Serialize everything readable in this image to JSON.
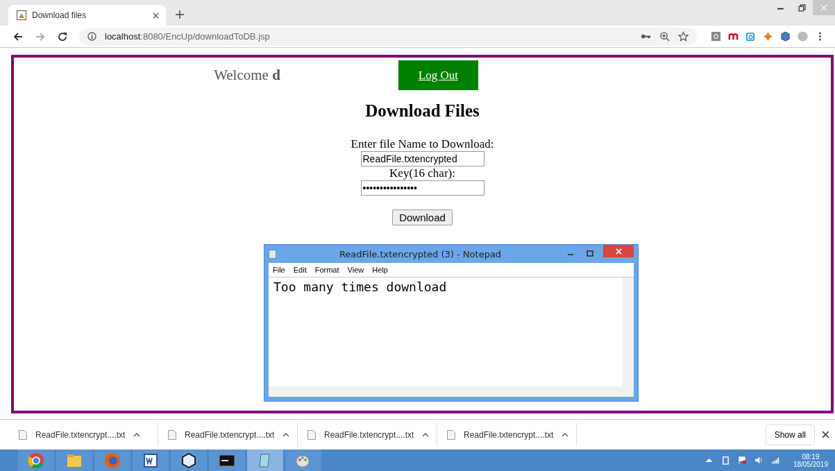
{
  "browser": {
    "tab_title": "Download files",
    "url_host": "localhost",
    "url_path": ":8080/EncUp/downloadToDB.jsp"
  },
  "page": {
    "welcome": "Welcome **d**",
    "logout": "Log Out",
    "heading": "Download Files",
    "file_label": "Enter file Name to Download:",
    "file_value": "ReadFile.txtencrypted",
    "key_label": "Key(16 char):",
    "key_value": "••••••••••••••••",
    "download": "Download"
  },
  "notepad": {
    "title": "ReadFile.txtencrypted (3) - Notepad",
    "menu": [
      "File",
      "Edit",
      "Format",
      "View",
      "Help"
    ],
    "text": "Too many times download"
  },
  "downloads": [
    {
      "name": "ReadFile.txtencrypt....txt"
    },
    {
      "name": "ReadFile.txtencrypt....txt"
    },
    {
      "name": "ReadFile.txtencrypt....txt"
    },
    {
      "name": "ReadFile.txtencrypt....txt"
    }
  ],
  "show_all": "Show all",
  "taskbar_apps": [
    {
      "selected": false
    },
    {
      "selected": false
    },
    {
      "selected": false
    },
    {
      "selected": false
    },
    {
      "selected": false
    },
    {
      "selected": false
    },
    {
      "selected": true
    },
    {
      "selected": false
    }
  ],
  "clock": {
    "time": "08:19",
    "date": "18/05/2019"
  }
}
